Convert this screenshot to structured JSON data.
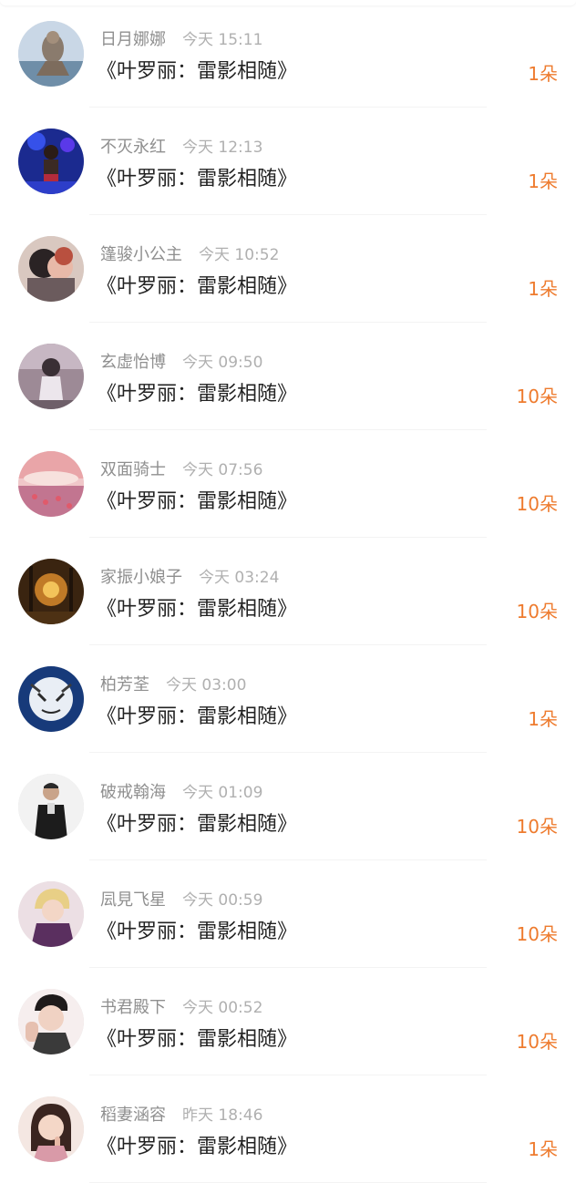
{
  "rows": [
    {
      "user": "日月娜娜",
      "time": "今天 15:11",
      "title": "《叶罗丽：雷影相随》",
      "amount": "1朵"
    },
    {
      "user": "不灭永红",
      "time": "今天 12:13",
      "title": "《叶罗丽：雷影相随》",
      "amount": "1朵"
    },
    {
      "user": "篷骏小公主",
      "time": "今天 10:52",
      "title": "《叶罗丽：雷影相随》",
      "amount": "1朵"
    },
    {
      "user": "玄虚怡博",
      "time": "今天 09:50",
      "title": "《叶罗丽：雷影相随》",
      "amount": "10朵"
    },
    {
      "user": "双面骑士",
      "time": "今天 07:56",
      "title": "《叶罗丽：雷影相随》",
      "amount": "10朵"
    },
    {
      "user": "家振小娘子",
      "time": "今天 03:24",
      "title": "《叶罗丽：雷影相随》",
      "amount": "10朵"
    },
    {
      "user": "柏芳荃",
      "time": "今天 03:00",
      "title": "《叶罗丽：雷影相随》",
      "amount": "1朵"
    },
    {
      "user": "破戒翰海",
      "time": "今天 01:09",
      "title": "《叶罗丽：雷影相随》",
      "amount": "10朵"
    },
    {
      "user": "凨見飞星",
      "time": "今天 00:59",
      "title": "《叶罗丽：雷影相随》",
      "amount": "10朵"
    },
    {
      "user": "书君殿下",
      "time": "今天 00:52",
      "title": "《叶罗丽：雷影相随》",
      "amount": "10朵"
    },
    {
      "user": "稻妻涵容",
      "time": "昨天 18:46",
      "title": "《叶罗丽：雷影相随》",
      "amount": "1朵"
    }
  ],
  "colors": {
    "amount": "#ee7b2e",
    "username": "#8f8f8f",
    "time": "#b0b0b0",
    "title": "#222222"
  }
}
